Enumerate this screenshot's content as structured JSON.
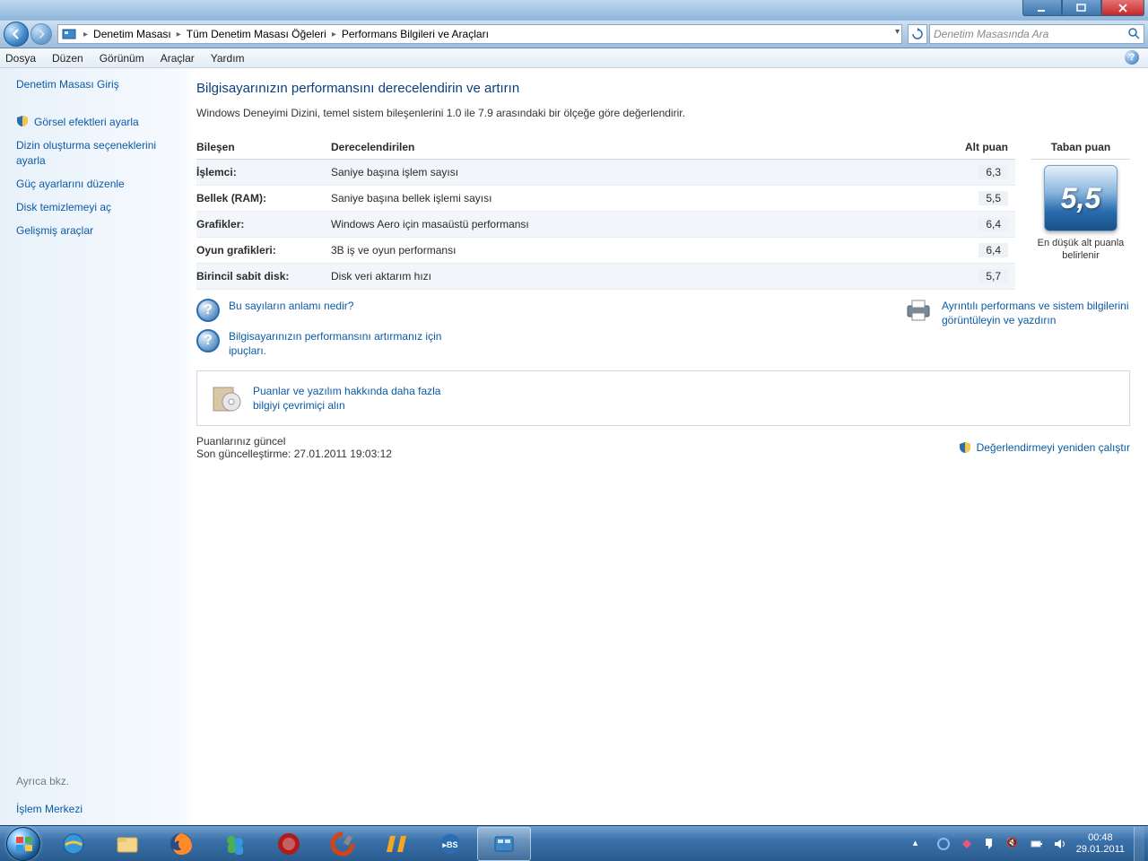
{
  "window": {
    "breadcrumbs": [
      "Denetim Masası",
      "Tüm Denetim Masası Öğeleri",
      "Performans Bilgileri ve Araçları"
    ],
    "search_placeholder": "Denetim Masasında Ara"
  },
  "menu": {
    "file": "Dosya",
    "edit": "Düzen",
    "view": "Görünüm",
    "tools": "Araçlar",
    "help": "Yardım"
  },
  "sidebar": {
    "home": "Denetim Masası Giriş",
    "links": [
      "Görsel efektleri ayarla",
      "Dizin oluşturma seçeneklerini ayarla",
      "Güç ayarlarını düzenle",
      "Disk temizlemeyi aç",
      "Gelişmiş araçlar"
    ],
    "see_also_header": "Ayrıca bkz.",
    "see_also_link": "İşlem Merkezi"
  },
  "main": {
    "title": "Bilgisayarınızın performansını derecelendirin ve artırın",
    "subtitle": "Windows Deneyimi Dizini, temel sistem bileşenlerini 1.0 ile 7.9 arasındaki bir ölçeğe göre değerlendirir.",
    "headers": {
      "component": "Bileşen",
      "rated": "Derecelendirilen",
      "subscore": "Alt puan",
      "base": "Taban puan"
    },
    "rows": [
      {
        "component": "İşlemci:",
        "rated": "Saniye başına işlem sayısı",
        "sub": "6,3"
      },
      {
        "component": "Bellek (RAM):",
        "rated": "Saniye başına bellek işlemi sayısı",
        "sub": "5,5"
      },
      {
        "component": "Grafikler:",
        "rated": "Windows Aero için masaüstü performansı",
        "sub": "6,4"
      },
      {
        "component": "Oyun grafikleri:",
        "rated": "3B iş ve oyun performansı",
        "sub": "6,4"
      },
      {
        "component": "Birincil sabit disk:",
        "rated": "Disk veri aktarım hızı",
        "sub": "5,7"
      }
    ],
    "base_score": "5,5",
    "base_caption": "En düşük alt puanla belirlenir",
    "link_meaning": "Bu sayıların anlamı nedir?",
    "link_tips": "Bilgisayarınızın performansını artırmanız için ipuçları.",
    "link_print": "Ayrıntılı performans ve sistem bilgilerini görüntüleyin ve yazdırın",
    "link_online": "Puanlar ve yazılım hakkında daha fazla bilgiyi çevrimiçi alın",
    "status_current": "Puanlarınız güncel",
    "status_updated_label": "Son güncelleştirme:",
    "status_updated_value": "27.01.2011 19:03:12",
    "rerun": "Değerlendirmeyi yeniden çalıştır"
  },
  "taskbar": {
    "clock_time": "00:48",
    "clock_date": "29.01.2011"
  }
}
